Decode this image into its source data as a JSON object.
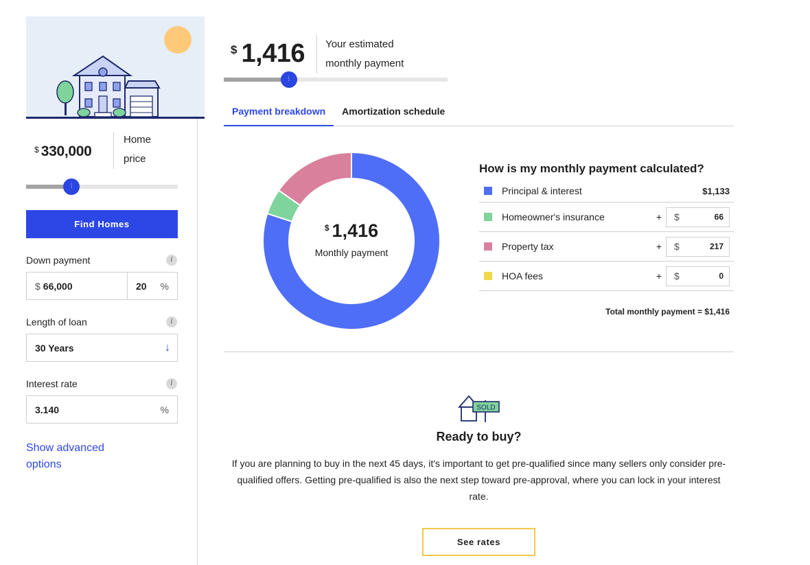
{
  "sidebar": {
    "home_price": {
      "currency": "$",
      "value": "330,000",
      "label": "Home price"
    },
    "price_slider": {
      "level_fraction": 0.3
    },
    "find_homes_label": "Find Homes",
    "down_payment": {
      "label": "Down payment",
      "currency": "$",
      "amount": "66,000",
      "percent": "20",
      "percent_symbol": "%",
      "info": "i"
    },
    "loan_length": {
      "label": "Length of loan",
      "value": "30 Years",
      "info": "i"
    },
    "interest_rate": {
      "label": "Interest rate",
      "value": "3.140",
      "symbol": "%",
      "info": "i"
    },
    "advanced_label": "Show advanced options"
  },
  "header": {
    "currency": "$",
    "payment": "1,416",
    "description": "Your estimated monthly payment",
    "slider": {
      "level_fraction": 0.29
    }
  },
  "tabs": [
    {
      "label": "Payment breakdown",
      "active": true
    },
    {
      "label": "Amortization schedule",
      "active": false
    }
  ],
  "chart_data": {
    "type": "pie",
    "center_currency": "$",
    "center_value": "1,416",
    "center_label": "Monthly payment",
    "slices": [
      {
        "label": "Principal & interest",
        "value": 1133,
        "color": "#4f6ef7"
      },
      {
        "label": "Homeowner's insurance",
        "value": 66,
        "color": "#7ed49b"
      },
      {
        "label": "Property tax",
        "value": 217,
        "color": "#d9809c"
      },
      {
        "label": "HOA fees",
        "value": 0,
        "color": "#f2d94a"
      }
    ]
  },
  "calc": {
    "title": "How is my monthly payment calculated?",
    "rows": [
      {
        "label": "Principal & interest",
        "value": "$1,133",
        "color": "#4f6ef7"
      },
      {
        "label": "Homeowner's insurance",
        "plus": "+",
        "currency": "$",
        "value": "66",
        "color": "#7ed49b"
      },
      {
        "label": "Property tax",
        "plus": "+",
        "currency": "$",
        "value": "217",
        "color": "#d9809c"
      },
      {
        "label": "HOA fees",
        "plus": "+",
        "currency": "$",
        "value": "0",
        "color": "#f2d94a"
      }
    ],
    "total": "Total monthly payment = $1,416"
  },
  "ready": {
    "sign_text": "SOLD",
    "title": "Ready to buy?",
    "body": "If you are planning to buy in the next 45 days, it's important to get pre-qualified since many sellers only consider pre-qualified offers. Getting pre-qualified is also the next step toward pre-approval, where you can lock in your interest rate.",
    "button_label": "See rates"
  }
}
